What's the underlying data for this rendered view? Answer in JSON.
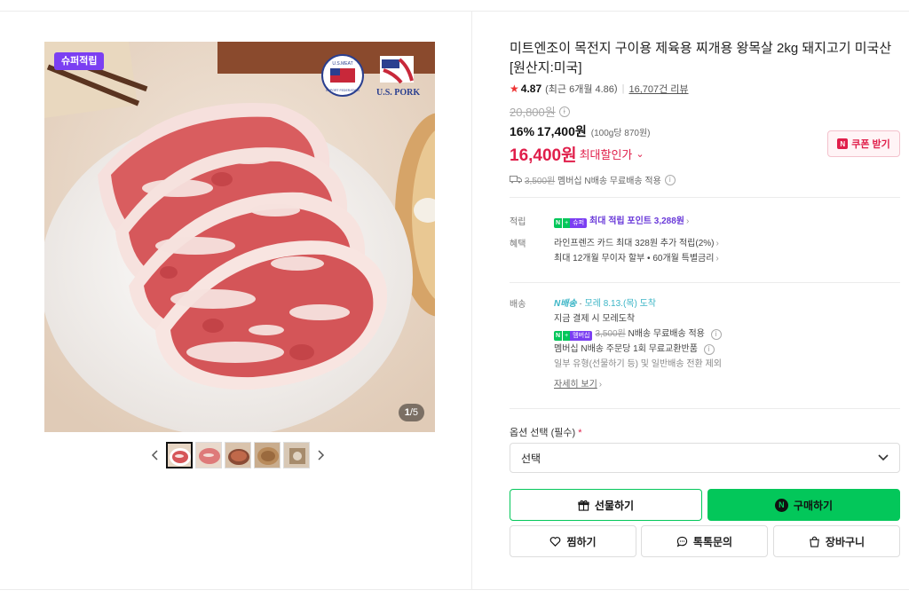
{
  "gallery": {
    "badge": "슈퍼적립",
    "counter_current": "1",
    "counter_total": "/5",
    "logos": {
      "usmef_text": "U.S.MEAT",
      "usmef_sub": "EXPORT FEDERATION",
      "uspork": "U.S. PORK"
    },
    "prev_icon": "chevron-left-icon",
    "next_icon": "chevron-right-icon"
  },
  "product": {
    "title": "미트엔조이 목전지 구이용 제육용 찌개용 왕목살 2kg 돼지고기 미국산 [원산지:미국]",
    "rating": "4.87",
    "rating_detail": "(최근 6개월 4.86",
    "review_count": "16,707건 리뷰",
    "original_price": "20,800원",
    "discount_pct": "16%",
    "sale_price": "17,400원",
    "unit_price": "(100g당 870원)",
    "best_price": "16,400원",
    "best_label": "최대할인가",
    "coupon_label": "쿠폰 받기",
    "coupon_n": "N",
    "member_ship_old": "3,500원",
    "member_ship_text": "멤버십 N배송 무료배송 적용"
  },
  "specs": {
    "points_label": "적립",
    "points_tag_n": "N",
    "points_tag_plus": "+",
    "points_tag_super": "슈퍼",
    "points_text": "최대 적립 포인트 3,288원",
    "benefit_label": "혜택",
    "benefit_line1": "라인프렌즈 카드 최대 328원 추가 적립(2%)",
    "benefit_line2": "최대 12개월 무이자 할부 • 60개월 특별금리",
    "delivery_label": "배송",
    "delivery_tag": "배송",
    "delivery_eta": "모레 8.13.(목) 도착",
    "delivery_line2": "지금 결제 시 모레도착",
    "delivery_tag_member": "멤버십",
    "delivery_old": "3,500원",
    "delivery_line3": "N배송 무료배송 적용",
    "delivery_line4": "멤버십 N배송 주문당 1회 무료교환반품",
    "delivery_line5": "일부 유형(선물하기 등) 및 일반배송 전환 제외",
    "detail_link": "자세히 보기"
  },
  "options": {
    "label": "옵션 선택 (필수)",
    "required_mark": "*",
    "select_value": "선택"
  },
  "actions": {
    "gift": "선물하기",
    "buy": "구매하기",
    "buy_logo": "N",
    "zzim": "찜하기",
    "talk": "톡톡문의",
    "cart": "장바구니"
  },
  "colors": {
    "naver_green": "#03c75a",
    "price_red": "#e01e4a",
    "super_purple": "#7b3ff2"
  }
}
